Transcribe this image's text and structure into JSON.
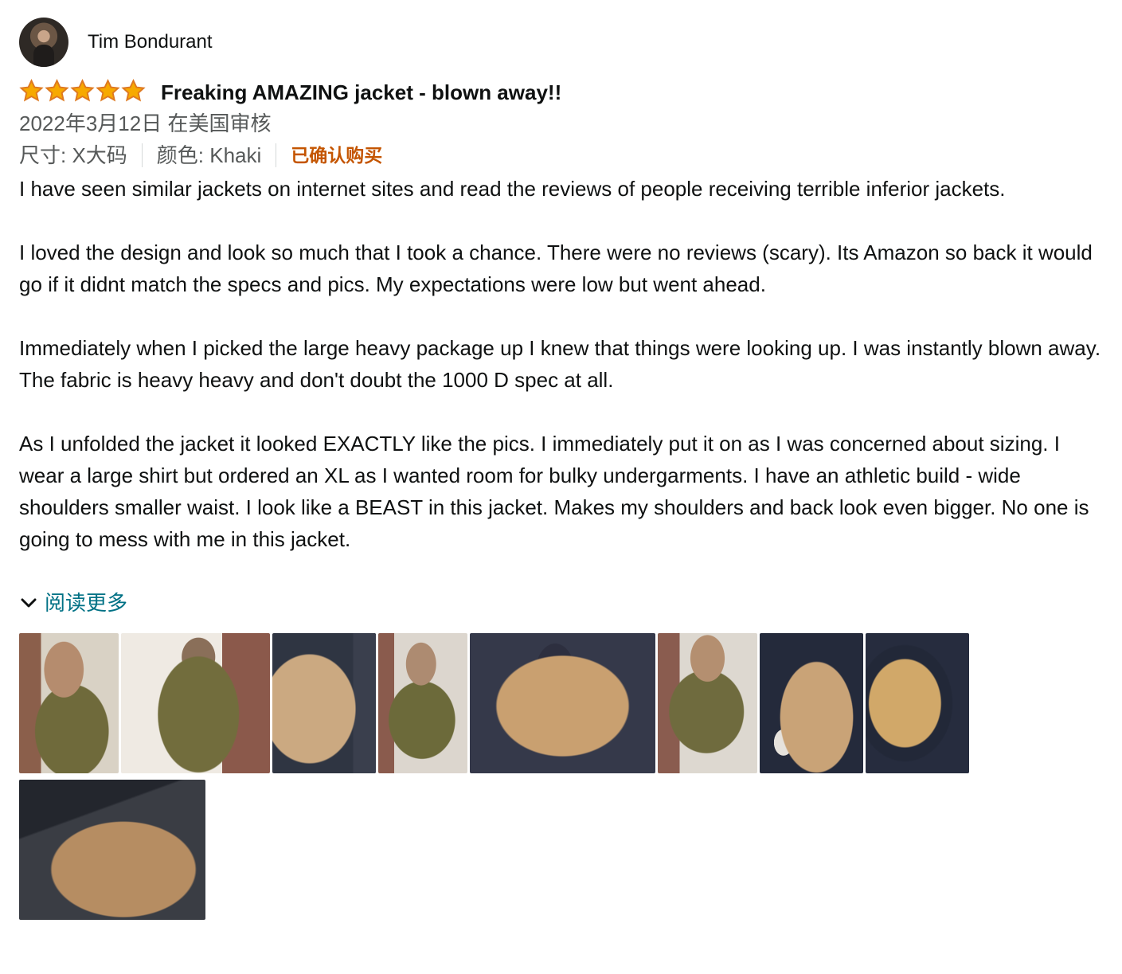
{
  "review": {
    "profile_name": "Tim Bondurant",
    "rating_text": "5.0 颗星，最多 5 颗星",
    "title": "Freaking AMAZING jacket - blown away!!",
    "date": "2022年3月12日 在美国审核",
    "size": "尺寸: X大码",
    "color": "颜色: Khaki",
    "verified": "已确认购买",
    "paragraphs": [
      "I have seen similar jackets on internet sites and read the reviews of people receiving terrible inferior jackets.",
      "I loved the design and look so much that I took a chance. There were no reviews (scary). Its Amazon so back it would go if it didnt match the specs and pics. My expectations were low but went ahead.",
      "Immediately when I picked the large heavy package up I knew that things were looking up. I was instantly blown away. The fabric is heavy heavy and don't doubt the 1000 D spec at all.",
      "As I unfolded the jacket it looked EXACTLY like the pics. I immediately put it on as I was concerned about sizing. I wear a large shirt but ordered an XL as I wanted room for bulky undergarments. I have an athletic build - wide shoulders smaller waist. I look like a BEAST in this jacket. Makes my shoulders and back look even bigger. No one is going to mess with me in this jacket."
    ],
    "read_more": "阅读更多"
  },
  "icons": {
    "star": "star-icon",
    "chevron": "chevron-down-icon"
  },
  "colors": {
    "star_fill": "#f7a900",
    "verified": "#c45500",
    "link": "#007185",
    "secondary_text": "#565959"
  }
}
